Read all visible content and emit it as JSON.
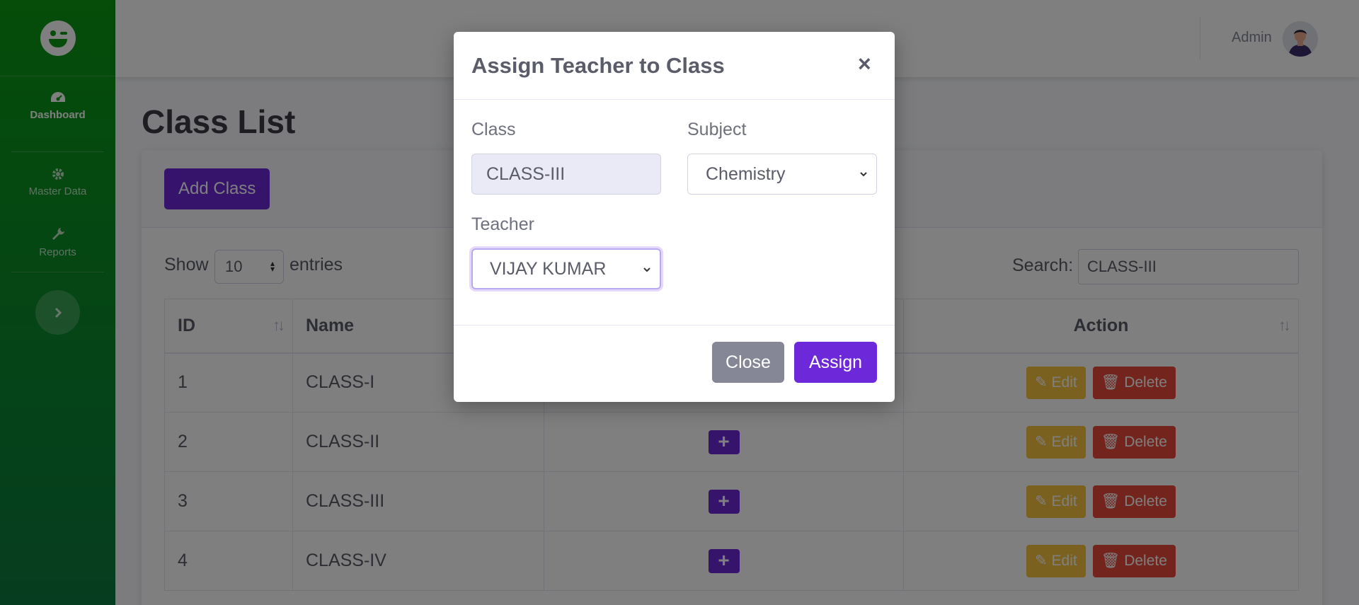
{
  "sidebar": {
    "logo_icon": "smiley-logo-icon",
    "items": [
      {
        "label": "Dashboard",
        "icon": "tachometer-icon",
        "active": true
      },
      {
        "label": "Master Data",
        "icon": "gear-icon",
        "active": false
      },
      {
        "label": "Reports",
        "icon": "wrench-icon",
        "active": false
      }
    ],
    "toggle_icon": "chevron-right-icon"
  },
  "topbar": {
    "user_name": "Admin",
    "avatar_icon": "user-avatar-icon"
  },
  "page": {
    "title": "Class List",
    "add_button": "Add Class",
    "show_label": "Show",
    "entries_value": "10",
    "entries_label": "entries",
    "search_label": "Search:",
    "search_value": "CLASS-III"
  },
  "table": {
    "columns": [
      "ID",
      "Name",
      "",
      "Action"
    ],
    "rows": [
      {
        "id": "1",
        "name": "CLASS-I"
      },
      {
        "id": "2",
        "name": "CLASS-II"
      },
      {
        "id": "3",
        "name": "CLASS-III"
      },
      {
        "id": "4",
        "name": "CLASS-IV"
      }
    ],
    "plus_label": "+",
    "edit_label": "Edit",
    "delete_label": "Delete"
  },
  "modal": {
    "title": "Assign Teacher to Class",
    "close_symbol": "×",
    "class_label": "Class",
    "class_value": "CLASS-III",
    "subject_label": "Subject",
    "subject_value": "Chemistry",
    "teacher_label": "Teacher",
    "teacher_value": "VIJAY KUMAR",
    "close_button": "Close",
    "assign_button": "Assign"
  },
  "colors": {
    "sidebar_green": "#0b9a12",
    "primary_purple": "#6d28d9",
    "warning_yellow": "#f6c23e",
    "danger_red": "#e74a3b",
    "secondary_gray": "#858796"
  }
}
